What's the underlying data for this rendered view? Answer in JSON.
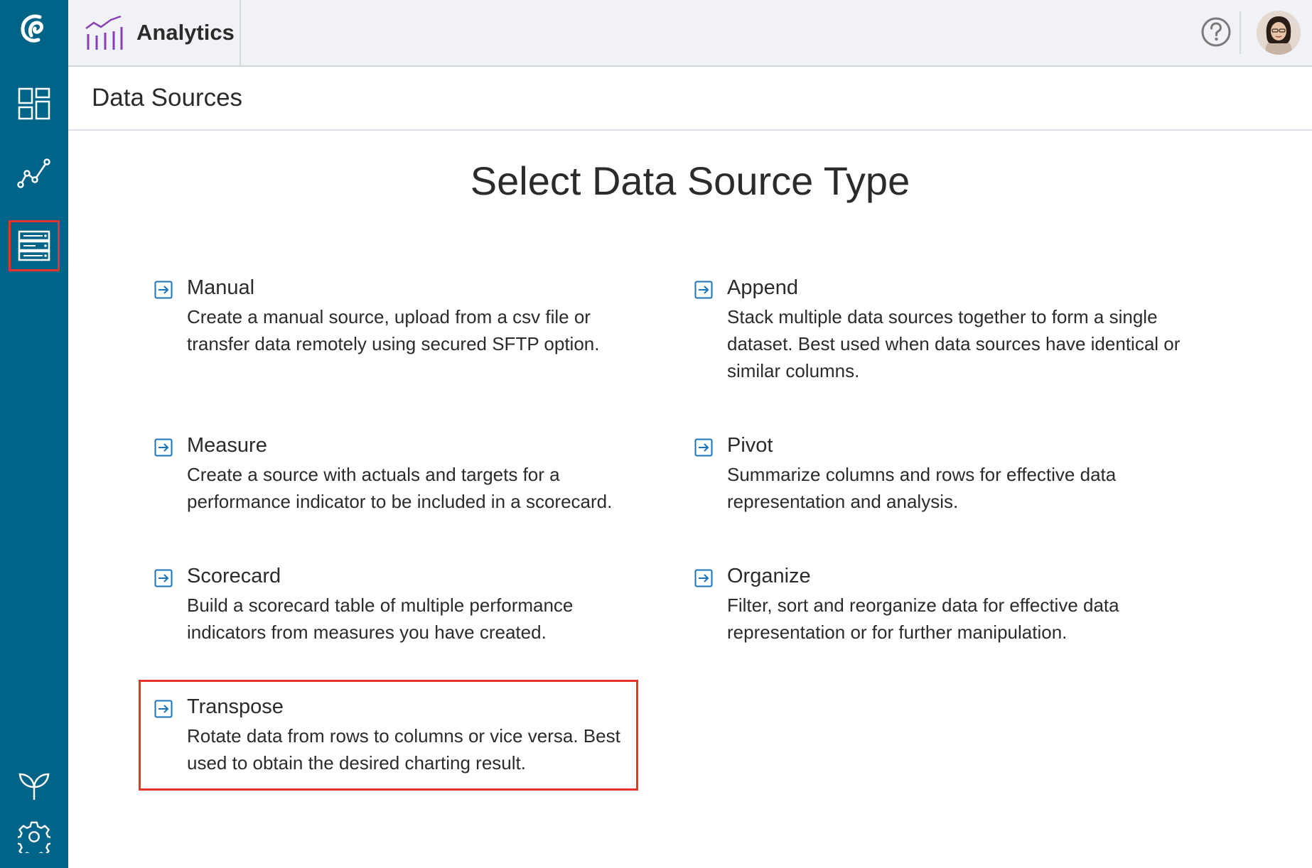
{
  "topbar": {
    "app_title": "Analytics",
    "help_icon": "question-circle-icon"
  },
  "page": {
    "title": "Data Sources",
    "heading": "Select Data Source Type"
  },
  "rail": {
    "items": [
      "logo-icon",
      "dashboard-grid-icon",
      "line-chart-icon",
      "data-sources-icon",
      "sprout-icon",
      "gear-icon"
    ],
    "active": "data-sources-icon"
  },
  "options": [
    {
      "title": "Manual",
      "desc": "Create a manual source, upload from a csv file or transfer data remotely using secured SFTP option."
    },
    {
      "title": "Append",
      "desc": "Stack multiple data sources together to form a single dataset. Best used when data sources have identical or similar columns."
    },
    {
      "title": "Measure",
      "desc": "Create a source with actuals and targets for a performance indicator to be included in a scorecard."
    },
    {
      "title": "Pivot",
      "desc": "Summarize columns and rows for effective data representation and analysis."
    },
    {
      "title": "Scorecard",
      "desc": "Build a scorecard table of multiple performance indicators from measures you have created."
    },
    {
      "title": "Organize",
      "desc": "Filter, sort and reorganize data for effective data representation or for further manipulation."
    },
    {
      "title": "Transpose",
      "desc": "Rotate data from rows to columns or vice versa. Best used to obtain the desired charting result."
    }
  ],
  "colors": {
    "rail": "#006488",
    "highlight": "#e8322c",
    "accent": "#1a73b8",
    "app_icon": "#8a3fb5"
  }
}
